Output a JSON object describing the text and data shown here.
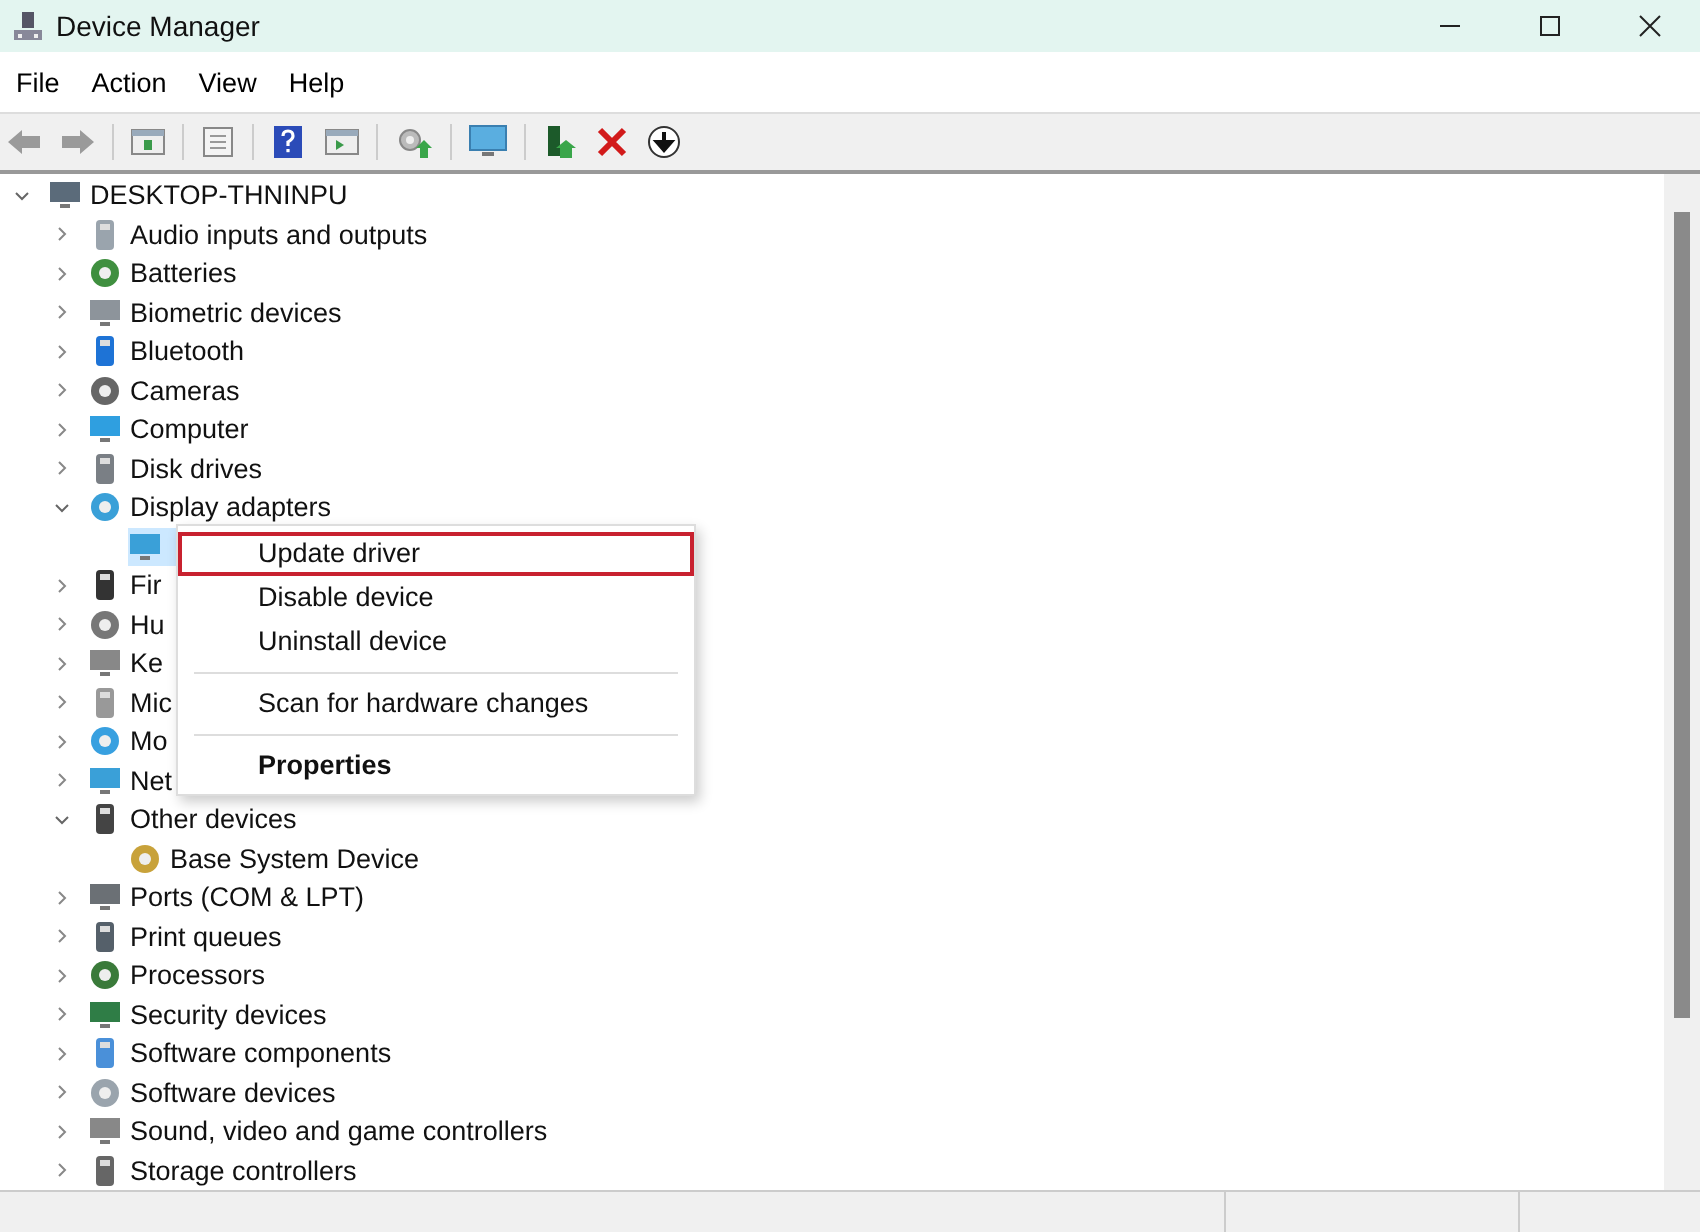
{
  "window": {
    "title": "Device Manager"
  },
  "menu": [
    "File",
    "Action",
    "View",
    "Help"
  ],
  "tree": {
    "label": "DESKTOP-THNINPU",
    "expanded": true,
    "selected": false,
    "children": [
      {
        "label": "Audio inputs and outputs",
        "expanded": false,
        "selected": false
      },
      {
        "label": "Batteries",
        "expanded": false,
        "selected": false
      },
      {
        "label": "Biometric devices",
        "expanded": false,
        "selected": false
      },
      {
        "label": "Bluetooth",
        "expanded": false,
        "selected": false
      },
      {
        "label": "Cameras",
        "expanded": false,
        "selected": false
      },
      {
        "label": "Computer",
        "expanded": false,
        "selected": false
      },
      {
        "label": "Disk drives",
        "expanded": false,
        "selected": false
      },
      {
        "label": "Display adapters",
        "expanded": true,
        "selected": false,
        "children": [
          {
            "selected": true
          }
        ]
      },
      {
        "label": "Fir",
        "expanded": false,
        "selected": false
      },
      {
        "label": "Hu",
        "expanded": false,
        "selected": false
      },
      {
        "label": "Ke",
        "expanded": false,
        "selected": false
      },
      {
        "label": "Mic",
        "expanded": false,
        "selected": false
      },
      {
        "label": "Mo",
        "expanded": false,
        "selected": false
      },
      {
        "label": "Net",
        "expanded": false,
        "selected": false
      },
      {
        "label": "Other devices",
        "expanded": true,
        "selected": false,
        "children": [
          {
            "label": "Base System Device",
            "selected": false
          }
        ]
      },
      {
        "label": "Ports (COM & LPT)",
        "expanded": false,
        "selected": false
      },
      {
        "label": "Print queues",
        "expanded": false,
        "selected": false
      },
      {
        "label": "Processors",
        "expanded": false,
        "selected": false
      },
      {
        "label": "Security devices",
        "expanded": false,
        "selected": false
      },
      {
        "label": "Software components",
        "expanded": false,
        "selected": false
      },
      {
        "label": "Software devices",
        "expanded": false,
        "selected": false
      },
      {
        "label": "Sound, video and game controllers",
        "expanded": false,
        "selected": false
      },
      {
        "label": "Storage controllers",
        "expanded": false,
        "selected": false
      }
    ]
  },
  "context_menu": [
    {
      "kind": "item",
      "label": "Update driver",
      "highlighted": true,
      "bold": false
    },
    {
      "kind": "item",
      "label": "Disable device",
      "highlighted": false,
      "bold": false
    },
    {
      "kind": "item",
      "label": "Uninstall device",
      "highlighted": false,
      "bold": false
    },
    {
      "kind": "separator"
    },
    {
      "kind": "item",
      "label": "Scan for hardware changes",
      "highlighted": false,
      "bold": false
    },
    {
      "kind": "separator"
    },
    {
      "kind": "item",
      "label": "Properties",
      "highlighted": false,
      "bold": true
    }
  ]
}
